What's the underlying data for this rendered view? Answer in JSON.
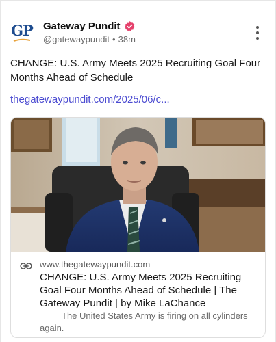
{
  "post": {
    "author": {
      "display_name": "Gateway Pundit",
      "handle": "@gatewaypundit",
      "separator": "•",
      "time_ago": "38m",
      "avatar_text": "GP",
      "verified_icon": "verified-badge-icon",
      "brand_color": "#1e4c8f",
      "badge_color": "#e5406b"
    },
    "text": "CHANGE: U.S. Army Meets 2025 Recruiting Goal Four Months Ahead of Schedule",
    "link_text": "thegatewaypundit.com/2025/06/c...",
    "link_color": "#4b4bd1",
    "more_icon": "more-vertical-icon",
    "link_card": {
      "image_description_icon": "preview-image",
      "link_icon": "link-icon",
      "domain": "www.thegatewaypundit.com",
      "title": "CHANGE: U.S. Army Meets 2025 Recruiting Goal Four Months Ahead of Schedule | The Gateway Pundit | by Mike LaChance",
      "description": "The United States Army is firing on all cylinders again."
    }
  }
}
